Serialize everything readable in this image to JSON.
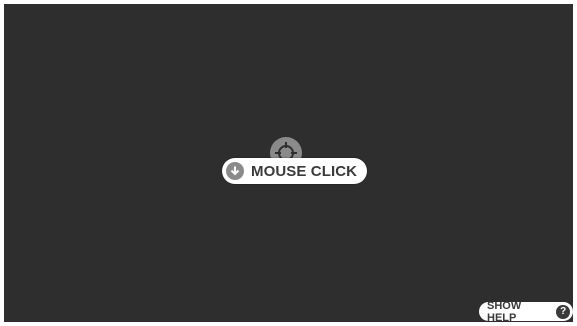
{
  "overlay": {
    "action_label": "MOUSE CLICK",
    "action_icon": "mouse-click-down-icon",
    "cursor_icon": "crosshair-icon"
  },
  "help": {
    "label": "SHOW HELP",
    "icon_text": "?"
  },
  "colors": {
    "background": "#2e2e2e",
    "pill": "#ffffff",
    "icon_gray": "#8a8a8a",
    "text": "#3a3a3a"
  }
}
